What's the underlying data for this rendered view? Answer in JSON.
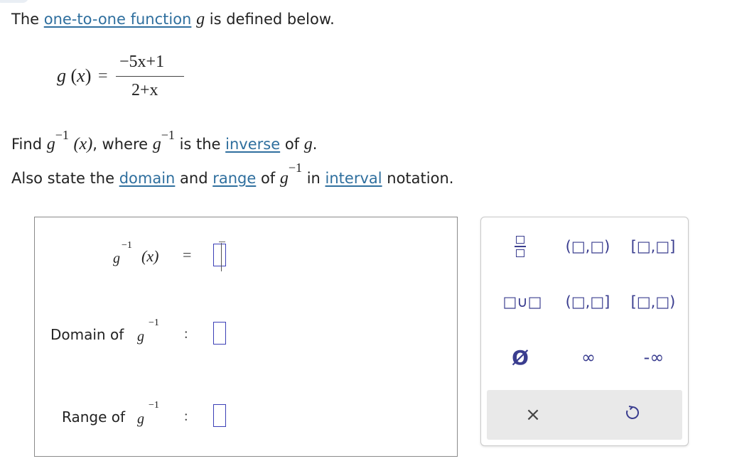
{
  "problem": {
    "line1": {
      "prefix": "The ",
      "link": "one-to-one function",
      "var": "g",
      "suffix": " is defined below."
    },
    "definition": {
      "lhs": "g(x)",
      "equals": "=",
      "numerator": "−5x+1",
      "denominator": "2+x"
    },
    "line2": {
      "find": "Find ",
      "g": "g",
      "sup": "−1",
      "arg": "(x)",
      "where": ", where ",
      "g2": "g",
      "sup2": "−1",
      "is_the": " is the ",
      "link": "inverse",
      "of": " of ",
      "var": "g",
      "period": "."
    },
    "line3": {
      "prefix": "Also state the ",
      "link_domain": "domain",
      "and": " and ",
      "link_range": "range",
      "of": " of ",
      "g": "g",
      "sup": "−1",
      "in": " in ",
      "link_interval": "interval",
      "suffix": " notation."
    }
  },
  "answer": {
    "row1": {
      "g": "g",
      "sup": "−1",
      "arg": "(x)",
      "sep": "=",
      "value": ""
    },
    "row2": {
      "label": "Domain of ",
      "g": "g",
      "sup": "−1",
      "sep": ":",
      "value": ""
    },
    "row3": {
      "label": "Range of ",
      "g": "g",
      "sup": "−1",
      "sep": ":",
      "value": ""
    }
  },
  "keypad": {
    "keys": {
      "fraction": "fraction-key",
      "open_open": "(□,□)",
      "closed_closed": "[□,□]",
      "union": "□∪□",
      "open_closed": "(□,□]",
      "closed_open": "[□,□)",
      "empty_set": "Ø",
      "infinity": "∞",
      "neg_infinity": "-∞",
      "clear": "×",
      "reset": "↺"
    }
  },
  "colors": {
    "link": "#2f6f9e",
    "keypad_glyph": "#3a3d8f",
    "slot_border": "#3b3fb6",
    "footer_bg": "#e9e9e9"
  }
}
